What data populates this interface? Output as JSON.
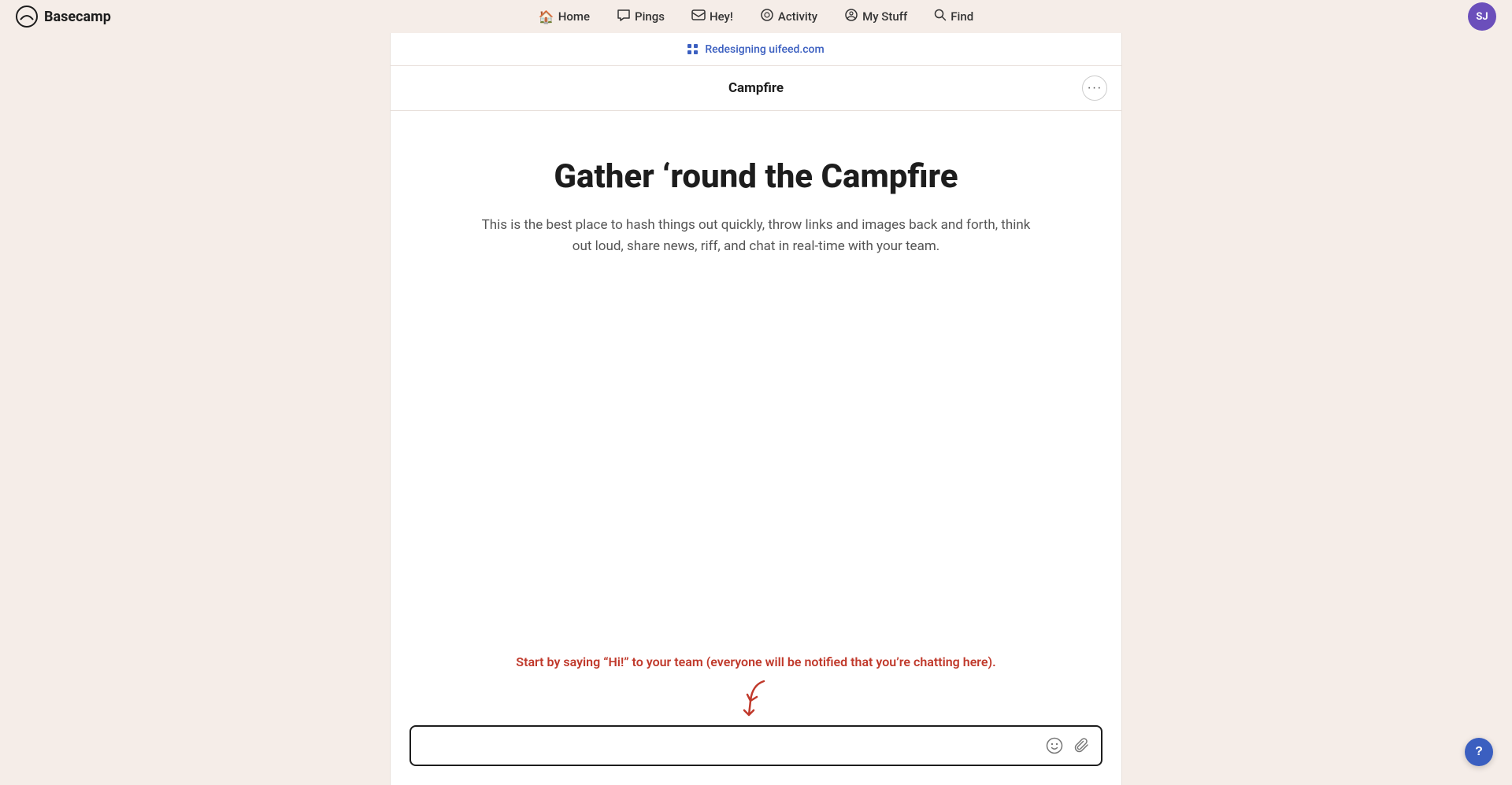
{
  "app": {
    "logo_text": "Basecamp",
    "logo_icon": "🏕"
  },
  "nav": {
    "items": [
      {
        "id": "home",
        "label": "Home",
        "icon": "🏠"
      },
      {
        "id": "pings",
        "label": "Pings",
        "icon": "💬"
      },
      {
        "id": "hey",
        "label": "Hey!",
        "icon": "📣"
      },
      {
        "id": "activity",
        "label": "Activity",
        "icon": "📊"
      },
      {
        "id": "my-stuff",
        "label": "My Stuff",
        "icon": "☺"
      },
      {
        "id": "find",
        "label": "Find",
        "icon": "🔍"
      }
    ],
    "avatar_initials": "SJ",
    "avatar_bg": "#6b4fbb"
  },
  "project_bar": {
    "link_text": "Redesigning uifeed.com",
    "link_color": "#3b5fc0"
  },
  "campfire": {
    "title": "Campfire",
    "menu_button_label": "···"
  },
  "hero": {
    "title": "Gather ‘round the Campfire",
    "description": "This is the best place to hash things out quickly, throw links and images back and forth, think out loud, share news, riff, and chat in real-time with your team."
  },
  "chat": {
    "cta_text": "Start by saying “Hi!” to your team (everyone will be notified that you’re chatting here).",
    "input_placeholder": "",
    "emoji_icon": "emoji",
    "attachment_icon": "attachment"
  },
  "help": {
    "label": "?"
  }
}
